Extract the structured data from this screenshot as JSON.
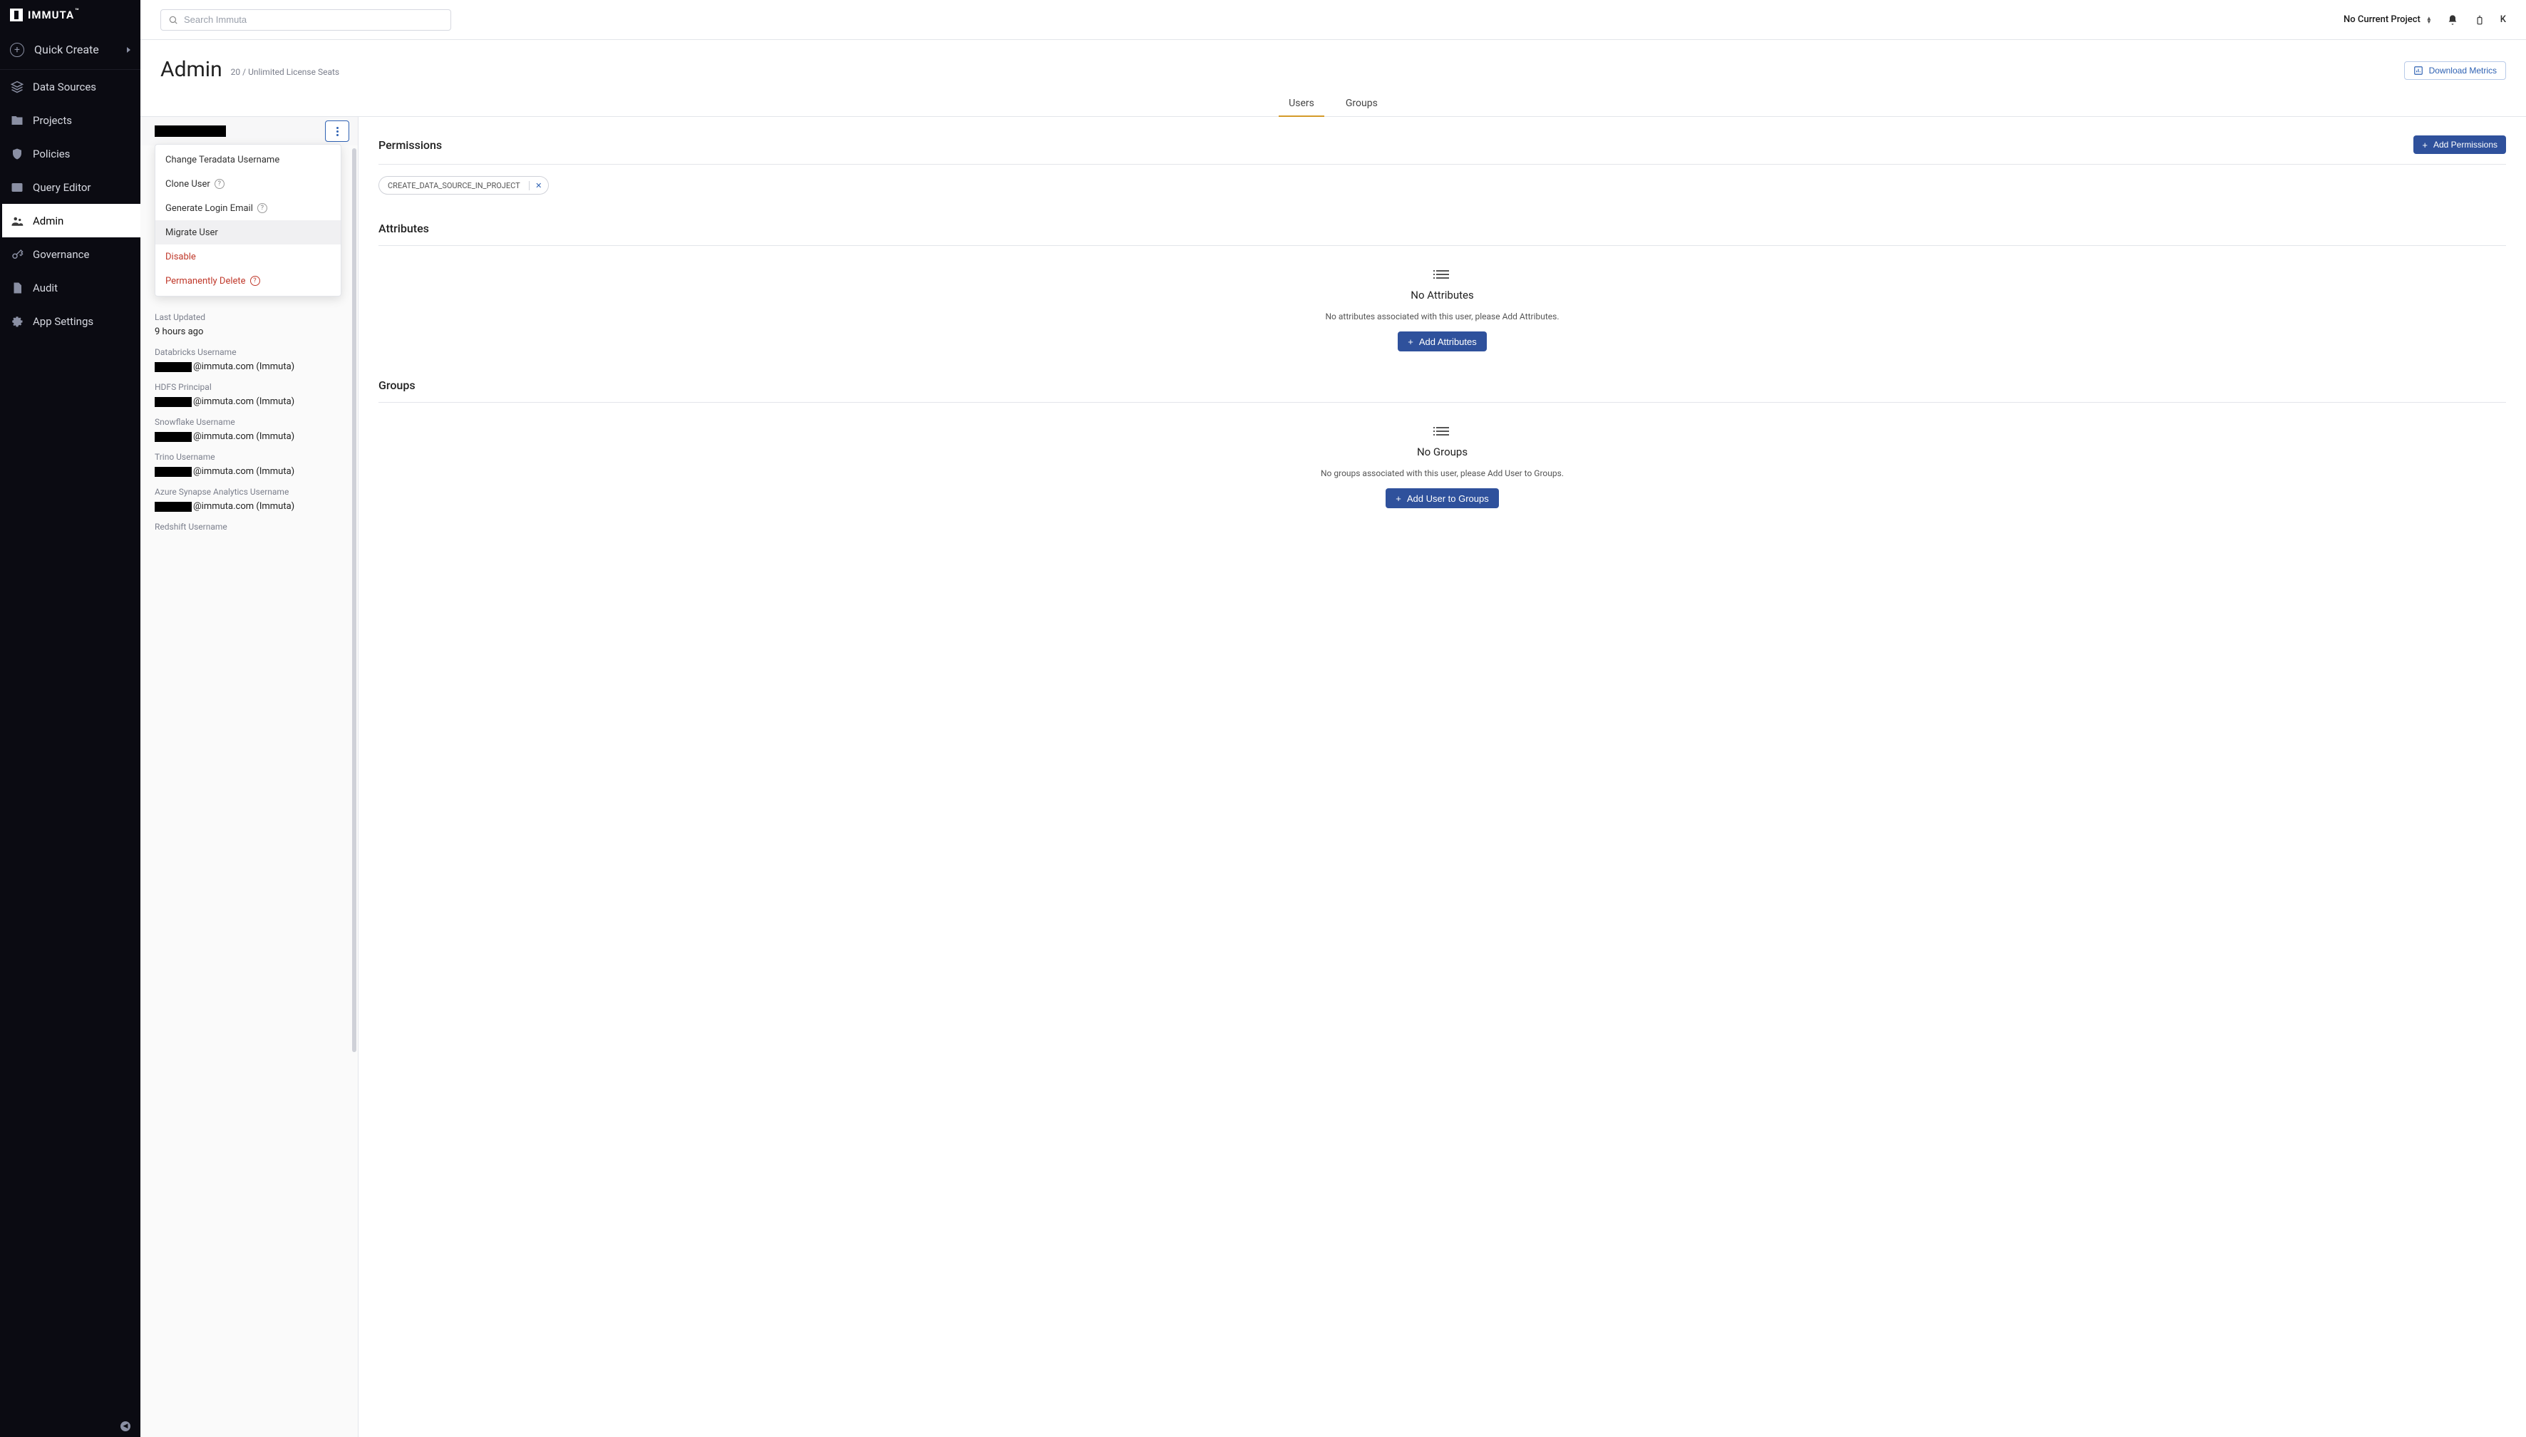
{
  "brand": "IMMUTA",
  "quick_create": {
    "label": "Quick Create"
  },
  "search": {
    "placeholder": "Search Immuta"
  },
  "project_picker": {
    "label": "No Current Project"
  },
  "avatar_letter": "K",
  "nav": {
    "data_sources": "Data Sources",
    "projects": "Projects",
    "policies": "Policies",
    "query_editor": "Query Editor",
    "admin": "Admin",
    "governance": "Governance",
    "audit": "Audit",
    "app_settings": "App Settings"
  },
  "page": {
    "title": "Admin",
    "license_seats": "20 / Unlimited License Seats",
    "download_metrics": "Download Metrics"
  },
  "tabs": {
    "users": "Users",
    "groups": "Groups"
  },
  "user_menu": {
    "change_teradata": "Change Teradata Username",
    "clone_user": "Clone User",
    "generate_login_email": "Generate Login Email",
    "migrate_user": "Migrate User",
    "disable": "Disable",
    "permanently_delete": "Permanently Delete"
  },
  "user_details": {
    "last_updated_label": "Last Updated",
    "last_updated_value": "9 hours ago",
    "databricks_label": "Databricks Username",
    "databricks_value": "@immuta.com (Immuta)",
    "hdfs_label": "HDFS Principal",
    "hdfs_value": "@immuta.com (Immuta)",
    "snowflake_label": "Snowflake Username",
    "snowflake_value": "@immuta.com (Immuta)",
    "trino_label": "Trino Username",
    "trino_value": "@immuta.com (Immuta)",
    "synapse_label": "Azure Synapse Analytics Username",
    "synapse_value": "@immuta.com (Immuta)",
    "redshift_label": "Redshift Username"
  },
  "permissions": {
    "title": "Permissions",
    "add_btn": "Add Permissions",
    "chip": "CREATE_DATA_SOURCE_IN_PROJECT"
  },
  "attributes": {
    "title": "Attributes",
    "empty_title": "No Attributes",
    "empty_desc": "No attributes associated with this user, please Add Attributes.",
    "add_btn": "Add Attributes"
  },
  "groups": {
    "title": "Groups",
    "empty_title": "No Groups",
    "empty_desc": "No groups associated with this user, please Add User to Groups.",
    "add_btn": "Add User to Groups"
  }
}
